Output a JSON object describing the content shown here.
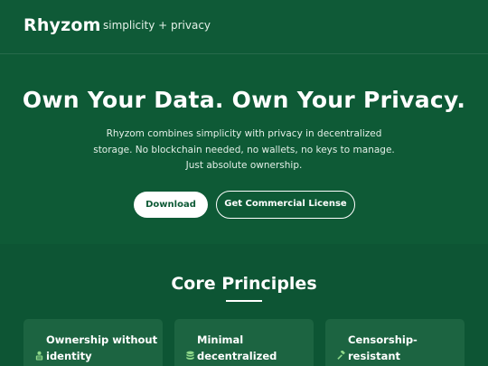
{
  "header": {
    "brand": "Rhyzom",
    "tagline": "simplicity + privacy"
  },
  "hero": {
    "title": "Own Your Data. Own Your Privacy.",
    "description": "Rhyzom combines simplicity with privacy in decentralized storage. No blockchain needed, no wallets, no keys to manage. Just absolute ownership.",
    "download_label": "Download",
    "license_label": "Get Commercial License"
  },
  "principles": {
    "title": "Core Principles",
    "cards": [
      {
        "title": "Ownership without identity",
        "icon": "user-lock-icon"
      },
      {
        "title": "Minimal decentralized",
        "icon": "database-icon"
      },
      {
        "title": "Censorship-resistant",
        "icon": "gavel-icon"
      }
    ]
  },
  "colors": {
    "background": "#0e5a36",
    "card": "#1c6441",
    "accent_icon": "#8fd98a",
    "text": "#ffffff"
  }
}
